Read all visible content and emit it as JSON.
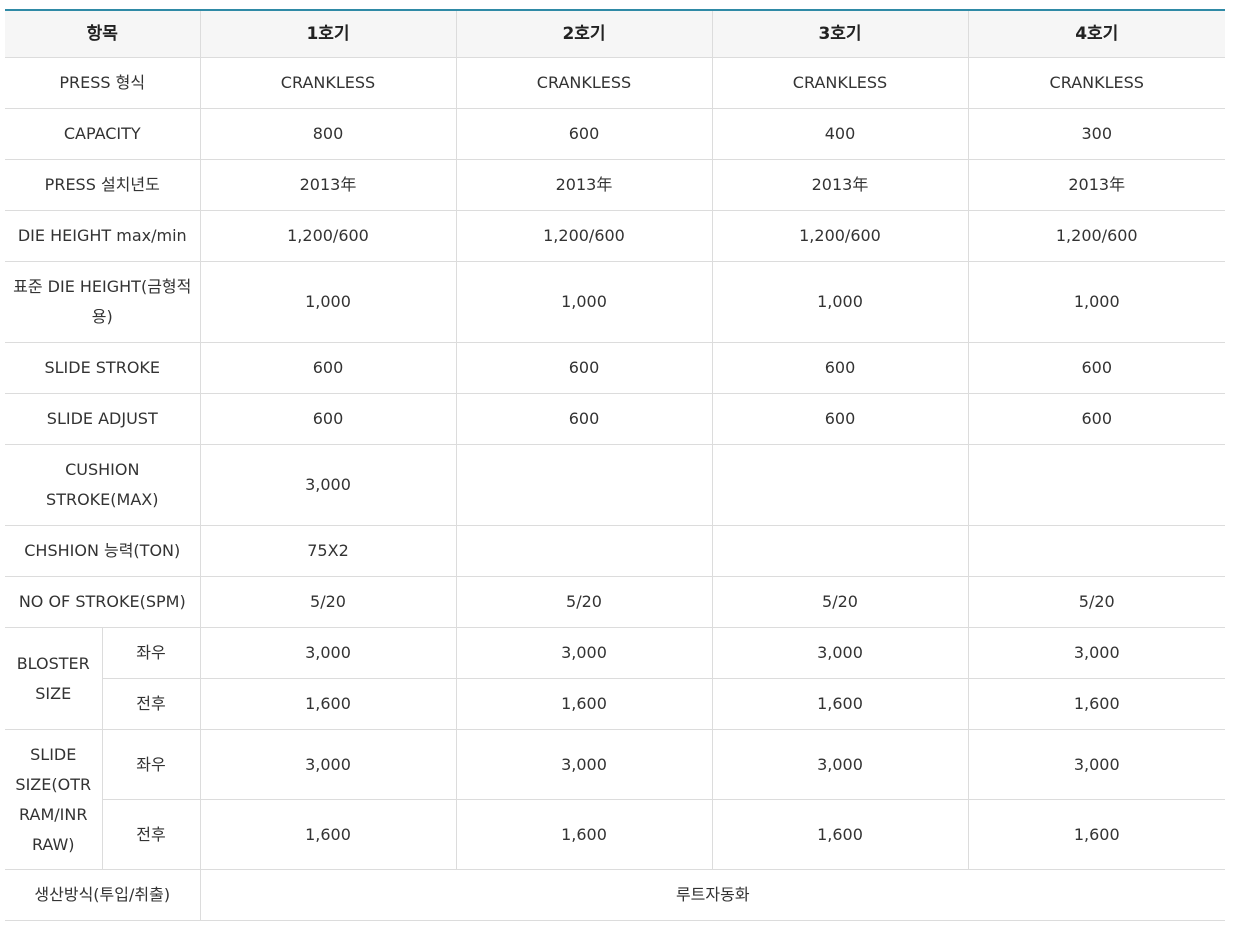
{
  "header": [
    "항목",
    "1호기",
    "2호기",
    "3호기",
    "4호기"
  ],
  "rows": {
    "press_type": {
      "label": "PRESS 형식",
      "values": [
        "CRANKLESS",
        "CRANKLESS",
        "CRANKLESS",
        "CRANKLESS"
      ]
    },
    "capacity": {
      "label": "CAPACITY",
      "values": [
        "800",
        "600",
        "400",
        "300"
      ]
    },
    "install_year": {
      "label": "PRESS 설치년도",
      "values": [
        "2013年",
        "2013年",
        "2013年",
        "2013年"
      ]
    },
    "die_height": {
      "label": "DIE HEIGHT max/min",
      "values": [
        "1,200/600",
        "1,200/600",
        "1,200/600",
        "1,200/600"
      ]
    },
    "std_die_height": {
      "label": "표준 DIE HEIGHT(금형적용)",
      "values": [
        "1,000",
        "1,000",
        "1,000",
        "1,000"
      ]
    },
    "slide_stroke": {
      "label": "SLIDE STROKE",
      "values": [
        "600",
        "600",
        "600",
        "600"
      ]
    },
    "slide_adjust": {
      "label": "SLIDE ADJUST",
      "values": [
        "600",
        "600",
        "600",
        "600"
      ]
    },
    "cushion_stroke": {
      "label": "CUSHION STROKE(MAX)",
      "values": [
        "3,000",
        "",
        "",
        ""
      ]
    },
    "cushion_capacity": {
      "label": "CHSHION 능력(TON)",
      "values": [
        "75X2",
        "",
        "",
        ""
      ]
    },
    "spm": {
      "label": "NO OF STROKE(SPM)",
      "values": [
        "5/20",
        "5/20",
        "5/20",
        "5/20"
      ]
    },
    "bolster": {
      "label": "BLOSTER SIZE",
      "lr": {
        "label": "좌우",
        "values": [
          "3,000",
          "3,000",
          "3,000",
          "3,000"
        ]
      },
      "fb": {
        "label": "전후",
        "values": [
          "1,600",
          "1,600",
          "1,600",
          "1,600"
        ]
      }
    },
    "slide_size": {
      "label": "SLIDE SIZE(OTR RAM/INR RAW)",
      "lr": {
        "label": "좌우",
        "values": [
          "3,000",
          "3,000",
          "3,000",
          "3,000"
        ]
      },
      "fb": {
        "label": "전후",
        "values": [
          "1,600",
          "1,600",
          "1,600",
          "1,600"
        ]
      }
    },
    "production": {
      "label": "생산방식(투입/취출)",
      "value": "루트자동화"
    }
  }
}
